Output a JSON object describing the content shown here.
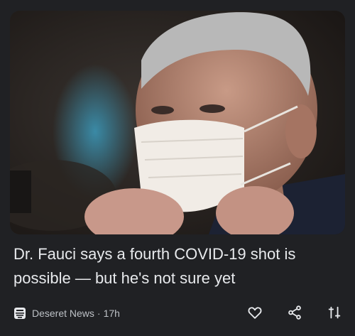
{
  "article": {
    "headline": "Dr. Fauci says a fourth COVID-19 shot is possible — but he's not sure yet",
    "image_alt": "Photo of Dr. Fauci adjusting a face mask"
  },
  "meta": {
    "source": "Deseret News",
    "separator": "·",
    "age": "17h",
    "source_icon": "deseret-news-logo-icon"
  },
  "actions": {
    "like_icon": "heart-icon",
    "share_icon": "share-icon",
    "more_icon": "less-like-this-icon"
  },
  "colors": {
    "background": "#202124",
    "headline_text": "#e8eaed",
    "meta_text": "#bdc1c6"
  }
}
